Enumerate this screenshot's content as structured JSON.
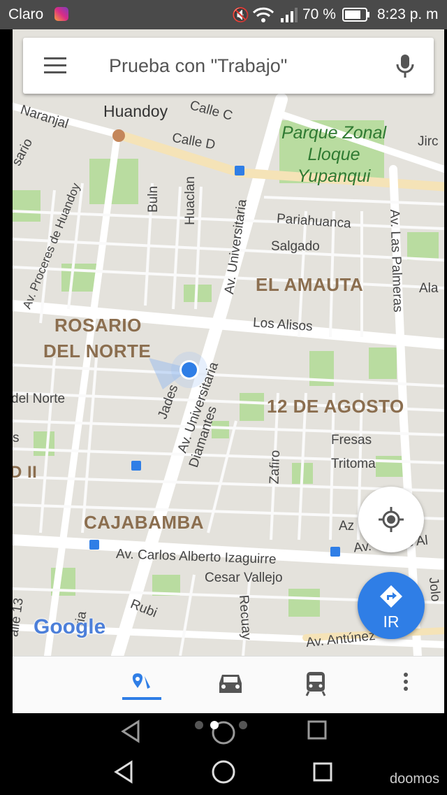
{
  "status_bar": {
    "carrier": "Claro",
    "battery": "70 %",
    "time": "8:23 p. m"
  },
  "search": {
    "query": "Prueba con \"Trabajo\""
  },
  "map": {
    "districts": [
      "Huandoy",
      "ROSARIO",
      "DEL NORTE",
      "EL AMAUTA",
      "12 DE AGOSTO",
      "CAJABAMBA"
    ],
    "park": [
      "Parque Zonal",
      "Lloque",
      "Yupanqui"
    ],
    "streets": {
      "naranjal": "Naranjal",
      "sario": "sario",
      "calle_c": "Calle C",
      "calle_d": "Calle D",
      "jiro": "Jirc",
      "proceres": "Av. Proceres de Huandoy",
      "buln": "Buln",
      "huaclan": "Huaclan",
      "universitaria_1": "Av. Universitaria",
      "pariahuanca": "Pariahuanca",
      "salgado": "Salgado",
      "las_palmeras": "Av. Las Palmeras",
      "ala": "Ala",
      "los_alisos": "Los Alisos",
      "del_norte": "del Norte",
      "s": "s",
      "d_ii": "D II",
      "jades": "Jades",
      "universitaria_2": "Av. Universitaria",
      "diamantes": "Diamantes",
      "zafiro": "Zafiro",
      "fresas": "Fresas",
      "tritoma": "Tritoma",
      "az": "Az",
      "carlos_alberto": "Av. Carlos Alberto Izaguirre",
      "carlos_right": "Av. Carlos Al",
      "cesar_vallejo": "Cesar Vallejo",
      "rubi": "Rubi",
      "recuay": "Recuay",
      "av_antunez": "Av. Antúnez",
      "calle_13": "alle 13",
      "ria": "ria",
      "jolo": "Jolo"
    },
    "logo": "Google"
  },
  "go_button": {
    "label": "IR"
  },
  "tabs": [
    {
      "name": "explore",
      "active": true
    },
    {
      "name": "driving",
      "active": false
    },
    {
      "name": "transit",
      "active": false
    },
    {
      "name": "more",
      "active": false
    }
  ],
  "watermark": "doomos",
  "colors": {
    "accent": "#2f7ee6",
    "map_bg": "#e4e2dc",
    "park": "#b9dca0",
    "status_bar": "#4a4a4a"
  }
}
